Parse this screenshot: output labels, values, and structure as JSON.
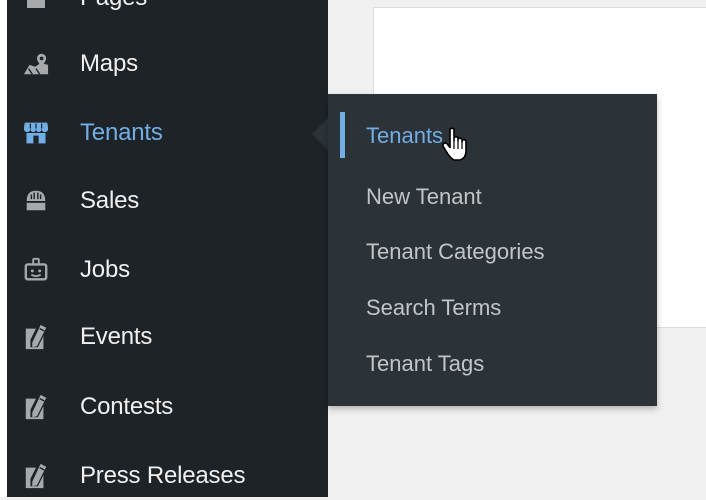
{
  "sidebar": {
    "items": [
      {
        "label": "Pages",
        "icon": "pages-icon"
      },
      {
        "label": "Maps",
        "icon": "map-icon"
      },
      {
        "label": "Tenants",
        "icon": "storefront-icon"
      },
      {
        "label": "Sales",
        "icon": "shopping-bag-icon"
      },
      {
        "label": "Jobs",
        "icon": "id-badge-icon"
      },
      {
        "label": "Events",
        "icon": "edit-page-icon"
      },
      {
        "label": "Contests",
        "icon": "edit-page-icon"
      },
      {
        "label": "Press Releases",
        "icon": "edit-page-icon"
      }
    ],
    "active_item": "Tenants"
  },
  "submenu": {
    "parent": "Tenants",
    "items": [
      {
        "label": "Tenants"
      },
      {
        "label": "New Tenant"
      },
      {
        "label": "Tenant Categories"
      },
      {
        "label": "Search Terms"
      },
      {
        "label": "Tenant Tags"
      }
    ],
    "current_item": "Tenants"
  },
  "colors": {
    "sidebar_bg": "#1d2327",
    "submenu_bg": "#2c3338",
    "accent": "#72aee6",
    "text": "#f0f0f1",
    "submenu_text": "#c3c4c7",
    "icon": "#a7aaad"
  }
}
